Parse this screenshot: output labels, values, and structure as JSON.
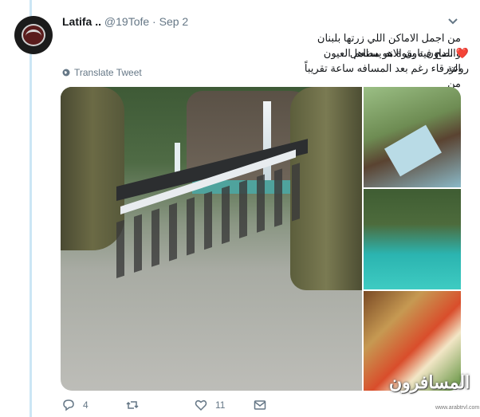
{
  "tweet": {
    "author_name": "Latifa ..",
    "handle": "@19Tofe",
    "separator": "·",
    "date": "Sep 2",
    "text_line1": "من اجمل الاماكن اللي زرتها بلبنان وانصح فيه بقوة هو مطعم العيون الزرقاء رغم بعد المسافه ساعة تقريباً من",
    "text_line2": "الداون تاون الانه يستاهل .. روعة",
    "heart": "❤️",
    "translate_label": "Translate Tweet"
  },
  "actions": {
    "reply_count": "4",
    "retweet_count": "",
    "like_count": "11"
  },
  "watermark": {
    "text": "المسافرون",
    "small": "www.arabtrvl.com"
  },
  "icons": [
    "chevron-down-icon",
    "globe-icon",
    "reply-icon",
    "retweet-icon",
    "heart-icon",
    "message-icon"
  ],
  "colors": {
    "thread_line": "#cce6f5",
    "secondary_text": "#657786",
    "heart": "#e0245e"
  }
}
